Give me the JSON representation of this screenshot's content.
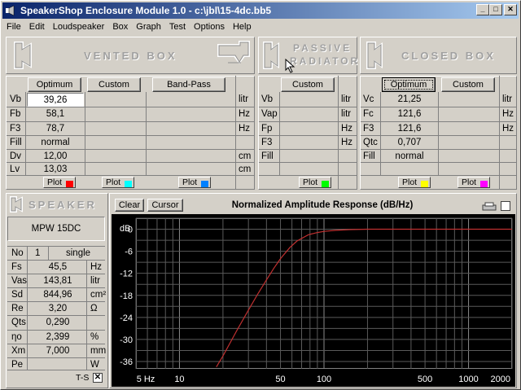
{
  "window": {
    "title": "SpeakerShop Enclosure Module 1.0 - c:\\jbl\\15-4dc.bb5"
  },
  "menu": [
    "File",
    "Edit",
    "Loudspeaker",
    "Box",
    "Graph",
    "Test",
    "Options",
    "Help"
  ],
  "headers": {
    "vented": "VENTED BOX",
    "passive_line1": "PASSIVE",
    "passive_line2": "RADIATOR",
    "closed": "CLOSED BOX",
    "speaker": "SPEAKER"
  },
  "vented": {
    "buttons": {
      "optimum": "Optimum",
      "custom": "Custom",
      "bandpass": "Band-Pass"
    },
    "rows": [
      {
        "label": "Vb",
        "value": "39,26",
        "unit": "litr"
      },
      {
        "label": "Fb",
        "value": "58,1",
        "unit": "Hz"
      },
      {
        "label": "F3",
        "value": "78,7",
        "unit": "Hz"
      },
      {
        "label": "Fill",
        "value": "normal",
        "unit": ""
      },
      {
        "label": "Dv",
        "value": "12,00",
        "unit": "cm"
      },
      {
        "label": "Lv",
        "value": "13,03",
        "unit": "cm"
      }
    ],
    "plot_label": "Plot"
  },
  "passive": {
    "buttons": {
      "custom": "Custom"
    },
    "rows": [
      {
        "label": "Vb",
        "unit": "litr"
      },
      {
        "label": "Vap",
        "unit": "litr"
      },
      {
        "label": "Fp",
        "unit": "Hz"
      },
      {
        "label": "F3",
        "unit": "Hz"
      },
      {
        "label": "Fill",
        "unit": ""
      }
    ],
    "plot_label": "Plot"
  },
  "closed": {
    "buttons": {
      "optimum": "Optimum",
      "custom": "Custom"
    },
    "rows": [
      {
        "label": "Vc",
        "value": "21,25",
        "unit": "litr"
      },
      {
        "label": "Fc",
        "value": "121,6",
        "unit": "Hz"
      },
      {
        "label": "F3",
        "value": "121,6",
        "unit": "Hz"
      },
      {
        "label": "Qtc",
        "value": "0,707",
        "unit": ""
      },
      {
        "label": "Fill",
        "value": "normal",
        "unit": ""
      }
    ],
    "plot_label": "Plot"
  },
  "plot_colors": {
    "vented1": "#ff0000",
    "vented2": "#00ffff",
    "vented3": "#0080ff",
    "passive": "#00ff00",
    "closed1": "#ffff00",
    "closed2": "#ff00ff"
  },
  "speaker": {
    "model": "MPW 15DC",
    "no_label": "No",
    "no_value": "1",
    "config": "single",
    "params": [
      {
        "label": "Fs",
        "value": "45,5",
        "unit": "Hz"
      },
      {
        "label": "Vas",
        "value": "143,81",
        "unit": "litr"
      },
      {
        "label": "Sd",
        "value": "844,96",
        "unit": "cm²"
      },
      {
        "label": "Re",
        "value": "3,20",
        "unit": "Ω"
      },
      {
        "label": "Qts",
        "value": "0,290",
        "unit": ""
      },
      {
        "label": "ηo",
        "value": "2,399",
        "unit": "%"
      },
      {
        "label": "Xm",
        "value": "7,000",
        "unit": "mm"
      },
      {
        "label": "Pe",
        "value": "",
        "unit": "W"
      }
    ],
    "ts_label": "T-S"
  },
  "graph": {
    "clear": "Clear",
    "cursor": "Cursor",
    "title": "Normalized Amplitude Response (dB/Hz)",
    "ylabel": "dB"
  },
  "chart_data": {
    "type": "line",
    "title": "Normalized Amplitude Response (dB/Hz)",
    "ylabel": "dB",
    "xscale": "log",
    "xlim": [
      5,
      2000
    ],
    "ylim": [
      -38,
      3
    ],
    "yticks": [
      0,
      -6,
      -12,
      -18,
      -24,
      -30,
      -36
    ],
    "xticks": [
      5,
      10,
      50,
      100,
      500,
      1000,
      2000
    ],
    "xtick_labels": [
      "5 Hz",
      "10",
      "50",
      "100",
      "500",
      "1000",
      "2000"
    ],
    "series": [
      {
        "color": "#c03030",
        "x": [
          18,
          20,
          25,
          30,
          35,
          40,
          45,
          50,
          58,
          65,
          78,
          90,
          100,
          120,
          150,
          200,
          500,
          1000,
          2000
        ],
        "y": [
          -37.5,
          -34.5,
          -27.5,
          -22,
          -17.5,
          -13.8,
          -10.6,
          -8,
          -5,
          -3.2,
          -1.5,
          -0.9,
          -0.6,
          -0.3,
          -0.1,
          0,
          0,
          0,
          0
        ]
      }
    ]
  }
}
